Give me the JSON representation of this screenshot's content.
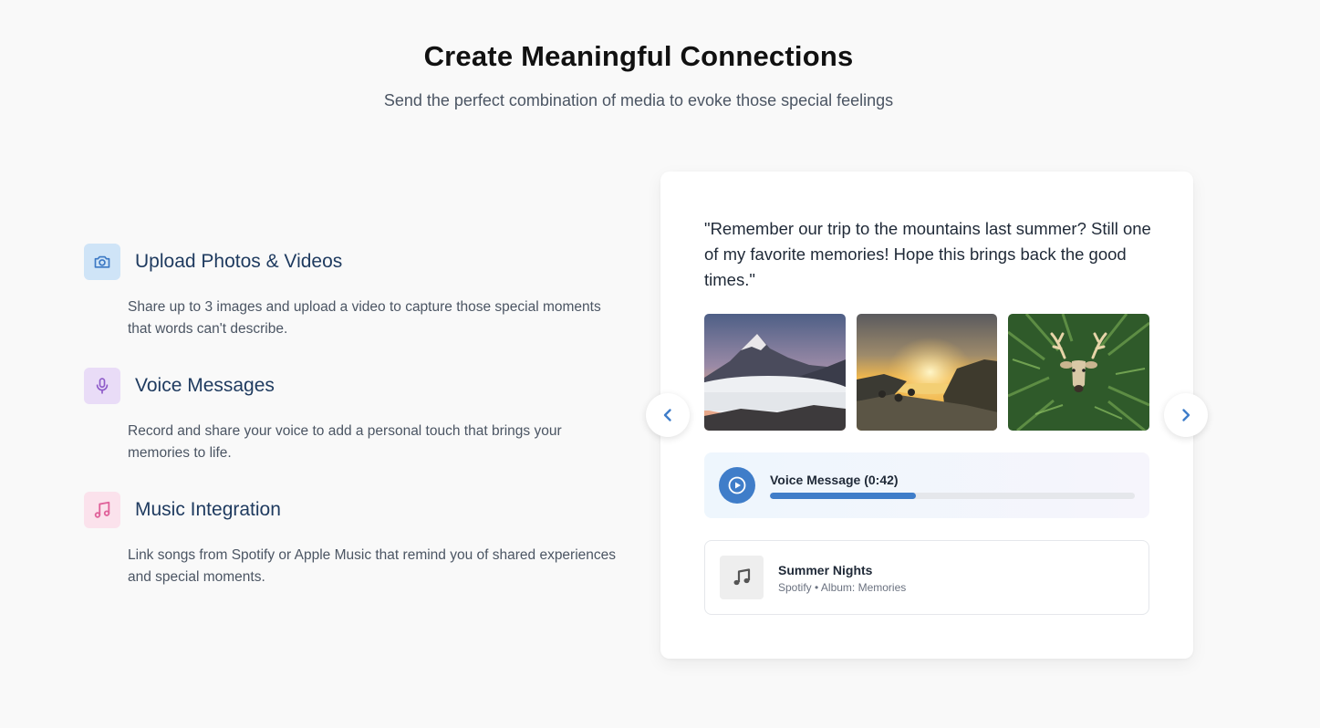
{
  "hero": {
    "title": "Create Meaningful Connections",
    "subtitle": "Send the perfect combination of media to evoke those special feelings"
  },
  "features": [
    {
      "icon": "camera-icon",
      "title": "Upload Photos & Videos",
      "description": "Share up to 3 images and upload a video to capture those special moments that words can't describe."
    },
    {
      "icon": "microphone-icon",
      "title": "Voice Messages",
      "description": "Record and share your voice to add a personal touch that brings your memories to life."
    },
    {
      "icon": "music-note-icon",
      "title": "Music Integration",
      "description": "Link songs from Spotify or Apple Music that remind you of shared experiences and special moments."
    }
  ],
  "preview": {
    "quote": "\"Remember our trip to the mountains last summer? Still one of my favorite memories! Hope this brings back the good times.\"",
    "photos": [
      "mountain-sunset-photo",
      "sunset-lake-photo",
      "deer-in-ferns-photo"
    ],
    "voice": {
      "label": "Voice Message (0:42)",
      "progress": 0.4
    },
    "music": {
      "title": "Summer Nights",
      "meta": "Spotify • Album: Memories"
    }
  },
  "colors": {
    "accent": "#3f7dc9",
    "heading": "#1e3a5f",
    "icon_blue": "#3b78c4",
    "icon_purple": "#8e5bc9",
    "icon_pink": "#e0629a"
  },
  "icons": {
    "prev": "chevron-left-icon",
    "next": "chevron-right-icon",
    "play": "play-icon",
    "album": "music-note-icon"
  }
}
